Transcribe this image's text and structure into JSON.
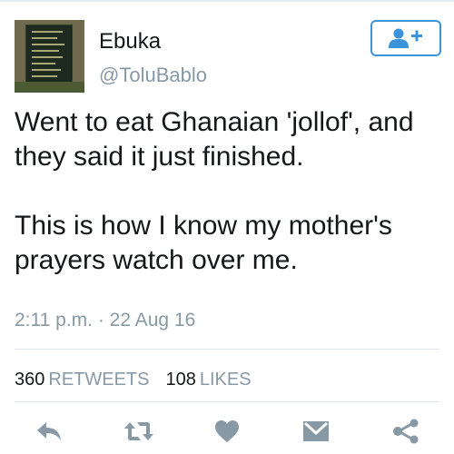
{
  "author": {
    "name": "Ebuka",
    "handle": "@ToluBablo"
  },
  "follow_button": {
    "icon": "follow-user-plus-icon"
  },
  "tweet": {
    "paragraph1": "Went to eat Ghanaian 'jollof', and they said it just finished.",
    "paragraph2": "This is how I know my mother's prayers watch over me.",
    "timestamp": "2:11 p.m. · 22 Aug 16"
  },
  "stats": {
    "retweets_count": "360",
    "retweets_label": "RETWEETS",
    "likes_count": "108",
    "likes_label": "LIKES"
  },
  "actions": [
    {
      "icon": "reply-icon"
    },
    {
      "icon": "retweet-icon"
    },
    {
      "icon": "heart-icon"
    },
    {
      "icon": "direct-message-icon"
    },
    {
      "icon": "share-icon"
    }
  ],
  "colors": {
    "accent": "#3b94d9",
    "text": "#14171a",
    "muted": "#8899a6",
    "icon": "#8899a6"
  }
}
